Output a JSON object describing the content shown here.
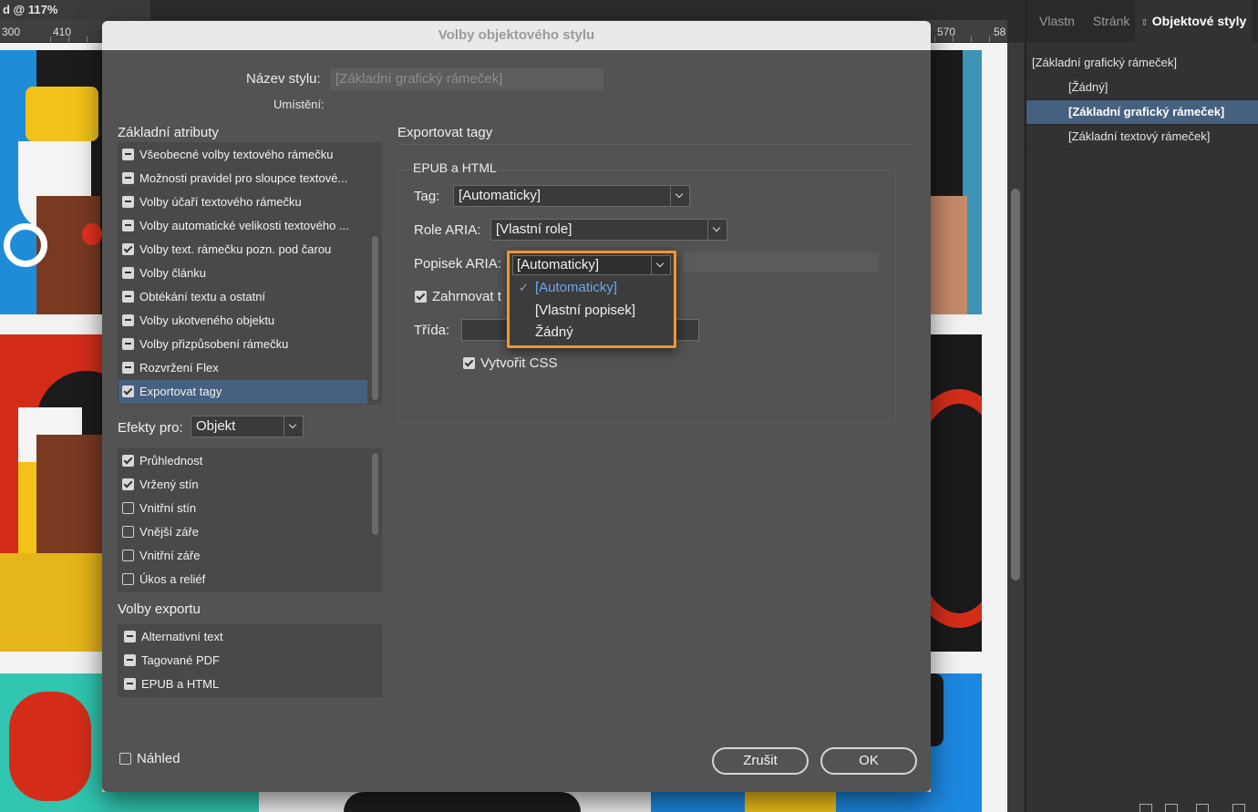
{
  "document": {
    "tab_label": "d @ 117%",
    "ruler_numbers": [
      "300",
      "410",
      "570",
      "58"
    ]
  },
  "panel": {
    "tabs": [
      "Vlastn",
      "Stránk",
      "Objektové styly"
    ],
    "items": [
      {
        "label": "[Základní grafický rámeček]",
        "level": "root"
      },
      {
        "label": "[Žádný]",
        "level": "child"
      },
      {
        "label": "[Základní grafický rámeček]",
        "level": "child",
        "selected": true
      },
      {
        "label": "[Základní textový rámeček]",
        "level": "child"
      }
    ]
  },
  "dialog": {
    "title": "Volby objektového stylu",
    "style_name_label": "Název stylu:",
    "style_name_value": "[Základní grafický rámeček]",
    "location_label": "Umístění:",
    "basic_attributes": {
      "title": "Základní atributy",
      "items": [
        {
          "label": "Všeobecné volby textového rámečku",
          "state": "mixed"
        },
        {
          "label": "Možnosti pravidel pro sloupce textové...",
          "state": "mixed"
        },
        {
          "label": "Volby účaří textového rámečku",
          "state": "mixed"
        },
        {
          "label": "Volby automatické velikosti textového ...",
          "state": "mixed"
        },
        {
          "label": "Volby text. rámečku pozn. pod čarou",
          "state": "on"
        },
        {
          "label": "Volby článku",
          "state": "mixed"
        },
        {
          "label": "Obtékání textu a ostatní",
          "state": "mixed"
        },
        {
          "label": "Volby ukotveného objektu",
          "state": "mixed"
        },
        {
          "label": "Volby přizpůsobení rámečku",
          "state": "mixed"
        },
        {
          "label": "Rozvržení Flex",
          "state": "mixed"
        },
        {
          "label": "Exportovat tagy",
          "state": "on",
          "selected": true
        }
      ]
    },
    "effects": {
      "label": "Efekty pro:",
      "value": "Objekt",
      "items": [
        {
          "label": "Průhlednost",
          "state": "on"
        },
        {
          "label": "Vržený stín",
          "state": "on"
        },
        {
          "label": "Vnitřní stín",
          "state": "off"
        },
        {
          "label": "Vnější záře",
          "state": "off"
        },
        {
          "label": "Vnitřní záře",
          "state": "off"
        },
        {
          "label": "Úkos a reliéf",
          "state": "off"
        }
      ]
    },
    "export_options": {
      "title": "Volby exportu",
      "items": [
        {
          "label": "Alternativní text",
          "state": "mixed"
        },
        {
          "label": "Tagované PDF",
          "state": "mixed"
        },
        {
          "label": "EPUB a HTML",
          "state": "mixed"
        }
      ]
    },
    "right": {
      "section_title": "Exportovat tagy",
      "group_title": "EPUB a HTML",
      "tag_label": "Tag:",
      "tag_value": "[Automaticky]",
      "aria_role_label": "Role ARIA:",
      "aria_role_value": "[Vlastní role]",
      "aria_label_label": "Popisek ARIA:",
      "aria_label_value": "[Automaticky]",
      "include_label": "Zahrnovat t",
      "class_label": "Třída:",
      "create_css_label": "Vytvořit CSS",
      "aria_label_options": [
        "[Automaticky]",
        "[Vlastní popisek]",
        "Žádný"
      ],
      "aria_label_checked": "[Automaticky]"
    },
    "preview_label": "Náhled",
    "cancel_label": "Zrušit",
    "ok_label": "OK"
  },
  "colors": {
    "accent_highlight": "#f0962d",
    "selection": "#46607f",
    "checked_option": "#6ea8ee"
  }
}
